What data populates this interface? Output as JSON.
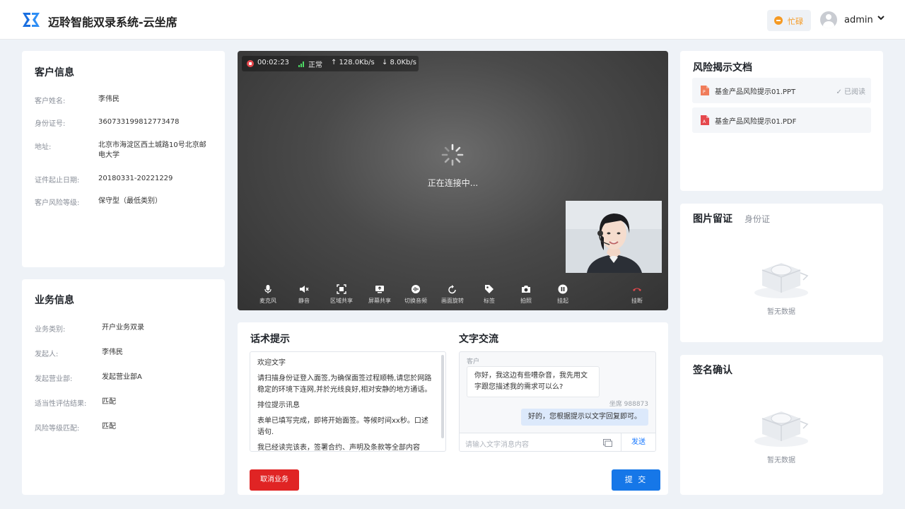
{
  "header": {
    "app_title": "迈聆智能双录系统-云坐席",
    "status_label": "忙碌",
    "user_name": "admin",
    "colors": {
      "brand": "#1677ff",
      "busy": "#f59a23"
    }
  },
  "customer_info": {
    "title": "客户信息",
    "fields": [
      {
        "label": "客户姓名:",
        "value": "李伟民"
      },
      {
        "label": "身份证号:",
        "value": "360733199812773478"
      },
      {
        "label": "地址:",
        "value": "北京市海淀区西土城路10号北京邮电大学"
      },
      {
        "label": "证件起止日期:",
        "value": "20180331-20221229"
      },
      {
        "label": "客户风险等级:",
        "value": "保守型（最低类别）"
      }
    ]
  },
  "business_info": {
    "title": "业务信息",
    "fields": [
      {
        "label": "业务类别:",
        "value": "开户业务双录"
      },
      {
        "label": "发起人:",
        "value": "李伟民"
      },
      {
        "label": "发起营业部:",
        "value": "发起营业部A"
      },
      {
        "label": "适当性评估结果:",
        "value": "匹配"
      },
      {
        "label": "风险等级匹配:",
        "value": "匹配"
      }
    ]
  },
  "video": {
    "timer": "00:02:23",
    "quality": "正常",
    "upload": "↑ 128.0Kb/s",
    "download": "↓ 8.0Kb/s",
    "connecting_text": "正在连接中...",
    "controls": [
      {
        "label": "麦克风",
        "icon": "microphone-icon"
      },
      {
        "label": "静音",
        "icon": "speaker-mute-icon"
      },
      {
        "label": "区域共享",
        "icon": "region-share-icon"
      },
      {
        "label": "屏幕共享",
        "icon": "screen-share-icon"
      },
      {
        "label": "切换音频",
        "icon": "audio-switch-icon"
      },
      {
        "label": "画面旋转",
        "icon": "rotate-icon"
      },
      {
        "label": "标签",
        "icon": "tag-icon"
      },
      {
        "label": "拍照",
        "icon": "camera-icon"
      },
      {
        "label": "挂起",
        "icon": "pause-icon"
      }
    ],
    "hangup_label": "挂断"
  },
  "script": {
    "title": "话术提示",
    "paragraphs": [
      "欢迎文字",
      "请扫描身份证登入面签,为确保面签过程顺畅,请您於网路稳定的环境下连网,并於光线良好,相对安静的地方通话。",
      "排位提示讯息",
      "表单已填写完成，即将开始面签。等候时间xx秒。口述语句.",
      "我已经读完该表，签署合约、声明及条款等全部内容"
    ]
  },
  "chat": {
    "title": "文字交流",
    "customer_label": "客户",
    "customer_message": "你好，我这边有些嘈杂音，我先用文字跟您描述我的需求可以么?",
    "agent_label": "坐席 988873",
    "agent_message": "好的，您根据提示以文字回复即可。",
    "input_placeholder": "请输入文字消息内容",
    "send_label": "发送"
  },
  "actions": {
    "cancel_label": "取消业务",
    "submit_label": "提 交"
  },
  "risk_docs": {
    "title": "风险揭示文档",
    "docs": [
      {
        "name": "基金产品风险提示01.PPT",
        "status": "✓ 已阅读"
      },
      {
        "name": "基金产品风险提示01.PDF",
        "status": ""
      }
    ]
  },
  "photo_retention": {
    "title": "图片留证",
    "tab": "身份证",
    "empty_text": "暂无数据"
  },
  "signature": {
    "title": "签名确认",
    "empty_text": "暂无数据"
  }
}
